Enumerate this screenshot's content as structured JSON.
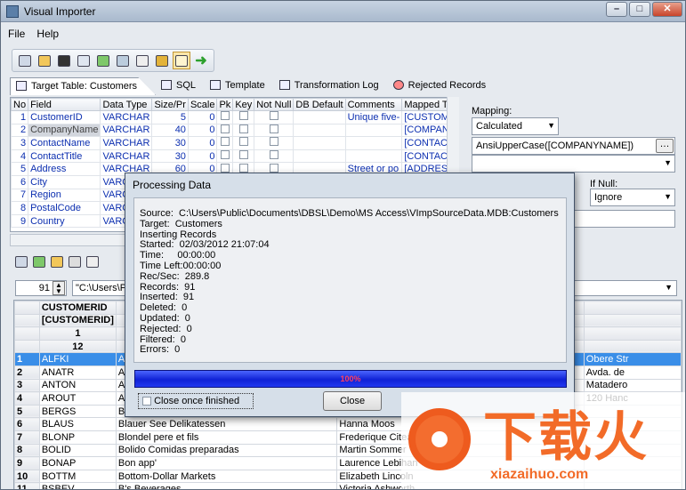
{
  "window": {
    "title": "Visual Importer"
  },
  "menu": [
    "File",
    "Help"
  ],
  "tabs": [
    {
      "label": "Target Table: Customers",
      "selected": true
    },
    {
      "label": "SQL"
    },
    {
      "label": "Template"
    },
    {
      "label": "Transformation Log"
    },
    {
      "label": "Rejected Records"
    }
  ],
  "fields_grid": {
    "headers": [
      "No",
      "Field",
      "Data Type",
      "Size/Pr",
      "Scale",
      "Pk",
      "Key",
      "Not Null",
      "DB Default",
      "Comments",
      "Mapped To"
    ],
    "rows": [
      {
        "no": "1",
        "field": "CustomerID",
        "type": "VARCHAR",
        "size": "5",
        "scale": "0",
        "comment": "Unique five-",
        "mapped": "[CUSTOMERID]"
      },
      {
        "no": "2",
        "field": "CompanyName",
        "type": "VARCHAR",
        "size": "40",
        "scale": "0",
        "comment": "",
        "mapped": "[COMPANYNAME]"
      },
      {
        "no": "3",
        "field": "ContactName",
        "type": "VARCHAR",
        "size": "30",
        "scale": "0",
        "comment": "",
        "mapped": "[CONTACTNAME]"
      },
      {
        "no": "4",
        "field": "ContactTitle",
        "type": "VARCHAR",
        "size": "30",
        "scale": "0",
        "comment": "",
        "mapped": "[CONTACTTITLE]"
      },
      {
        "no": "5",
        "field": "Address",
        "type": "VARCHAR",
        "size": "60",
        "scale": "0",
        "comment": "Street or po",
        "mapped": "[ADDRESS]"
      },
      {
        "no": "6",
        "field": "City",
        "type": "VARCH",
        "size": "",
        "scale": "",
        "comment": "",
        "mapped": ""
      },
      {
        "no": "7",
        "field": "Region",
        "type": "VARCH",
        "size": "",
        "scale": "",
        "comment": "",
        "mapped": ""
      },
      {
        "no": "8",
        "field": "PostalCode",
        "type": "VARCH",
        "size": "",
        "scale": "",
        "comment": "",
        "mapped": ""
      },
      {
        "no": "9",
        "field": "Country",
        "type": "VARCH",
        "size": "",
        "scale": "",
        "comment": "",
        "mapped": ""
      }
    ]
  },
  "mapping": {
    "label": "Mapping:",
    "value": "Calculated",
    "expression": "AnsiUpperCase([COMPANYNAME])",
    "ifnull_label": "If Null:",
    "ifnull_value": "Ignore"
  },
  "nav": {
    "record": "91",
    "path": "\"C:\\Users\\Pub"
  },
  "data_grid": {
    "col_headers": [
      "CUSTOMERID",
      "[CUSTOMERID]",
      "1",
      "12"
    ],
    "rows": [
      {
        "n": "1",
        "id": "ALFKI",
        "name": "Alfr",
        "contact": "",
        "addr": "Obere Str"
      },
      {
        "n": "2",
        "id": "ANATR",
        "name": "Ana",
        "contact": "",
        "addr": "Avda. de"
      },
      {
        "n": "3",
        "id": "ANTON",
        "name": "Ant",
        "contact": "",
        "addr": "Matadero"
      },
      {
        "n": "4",
        "id": "AROUT",
        "name": "Aro",
        "contact": "",
        "addr": "120 Hanc"
      },
      {
        "n": "5",
        "id": "BERGS",
        "name": "Ber",
        "contact": "",
        "addr": ""
      },
      {
        "n": "6",
        "id": "BLAUS",
        "name": "Blauer See Delikatessen",
        "contact": "Hanna Moos",
        "addr": ""
      },
      {
        "n": "7",
        "id": "BLONP",
        "name": "Blondel pere et fils",
        "contact": "Frederique Citeaux",
        "addr": ""
      },
      {
        "n": "8",
        "id": "BOLID",
        "name": "Bolido Comidas preparadas",
        "contact": "Martin Sommer",
        "addr": ""
      },
      {
        "n": "9",
        "id": "BONAP",
        "name": "Bon app'",
        "contact": "Laurence Lebihan",
        "addr": ""
      },
      {
        "n": "10",
        "id": "BOTTM",
        "name": "Bottom-Dollar Markets",
        "contact": "Elizabeth Lincoln",
        "addr": ""
      },
      {
        "n": "11",
        "id": "BSBEV",
        "name": "B's Beverages",
        "contact": "Victoria Ashworth",
        "addr": ""
      }
    ]
  },
  "dialog": {
    "title": "Processing Data",
    "lines": [
      "Source:  C:\\Users\\Public\\Documents\\DBSL\\Demo\\MS Access\\VImpSourceData.MDB:Customers",
      "Target:  Customers",
      "Inserting Records",
      "Started:  02/03/2012 21:07:04",
      "Time:     00:00:00",
      "Time Left:00:00:00",
      "Rec/Sec:  289.8",
      "Records:  91",
      "Inserted:  91",
      "Deleted:  0",
      "Updated:  0",
      "Rejected:  0",
      "Filtered:  0",
      "Errors:  0"
    ],
    "progress_label": "100%",
    "progress": 1.0,
    "checkbox_label": "Close once finished",
    "close_button": "Close"
  },
  "watermark": {
    "chinese": "下载火",
    "url": "xiazaihuo.com"
  },
  "colors": {
    "selection": "#3a8ee8",
    "field_text": "#0c2fb0",
    "watermark": "#f26b28"
  }
}
